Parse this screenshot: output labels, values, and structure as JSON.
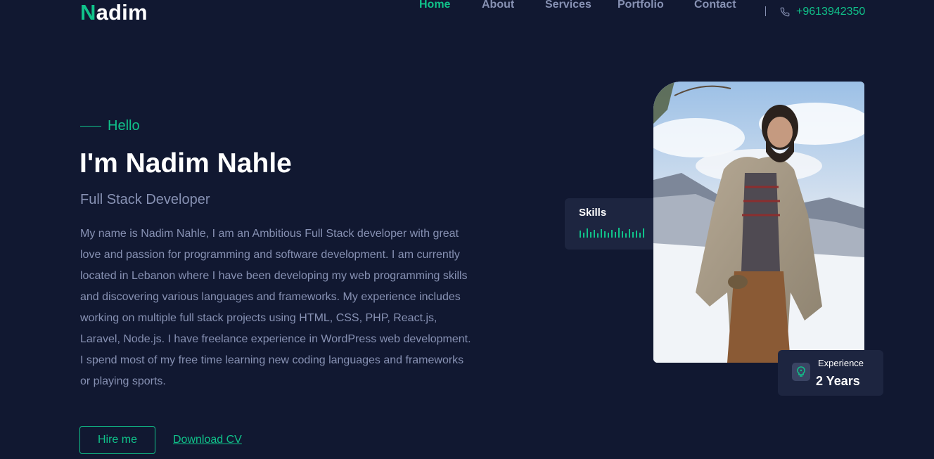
{
  "header": {
    "logo_first": "N",
    "logo_rest": "adim",
    "nav": [
      {
        "label": "Home",
        "active": true
      },
      {
        "label": "About",
        "active": false
      },
      {
        "label": "Services",
        "active": false
      },
      {
        "label": "Portfolio",
        "active": false
      },
      {
        "label": "Contact",
        "active": false
      }
    ],
    "phone": "+9613942350",
    "phone_icon": "phone-icon"
  },
  "hero": {
    "greeting": "Hello",
    "title": "I'm Nadim Nahle",
    "role": "Full Stack Developer",
    "bio": "My name is Nadim Nahle, I am an Ambitious Full Stack developer with great love and passion for programming and software development. I am currently located in Lebanon where I have been developing my web programming skills and discovering various languages and frameworks. My experience includes working on multiple full stack projects using HTML, CSS, PHP, React.js, Laravel, Node.js. I have freelance experience in WordPress web development. I spend most of my free time learning new coding languages and frameworks or playing sports.",
    "hire_button": "Hire me",
    "download_link": "Download CV"
  },
  "skills_card": {
    "title": "Skills"
  },
  "experience_card": {
    "label": "Experience",
    "value": "2 Years",
    "icon": "lightbulb-icon"
  },
  "colors": {
    "background": "#111831",
    "accent": "#10c28a",
    "muted": "#8791b3",
    "card": "#1d2540"
  }
}
